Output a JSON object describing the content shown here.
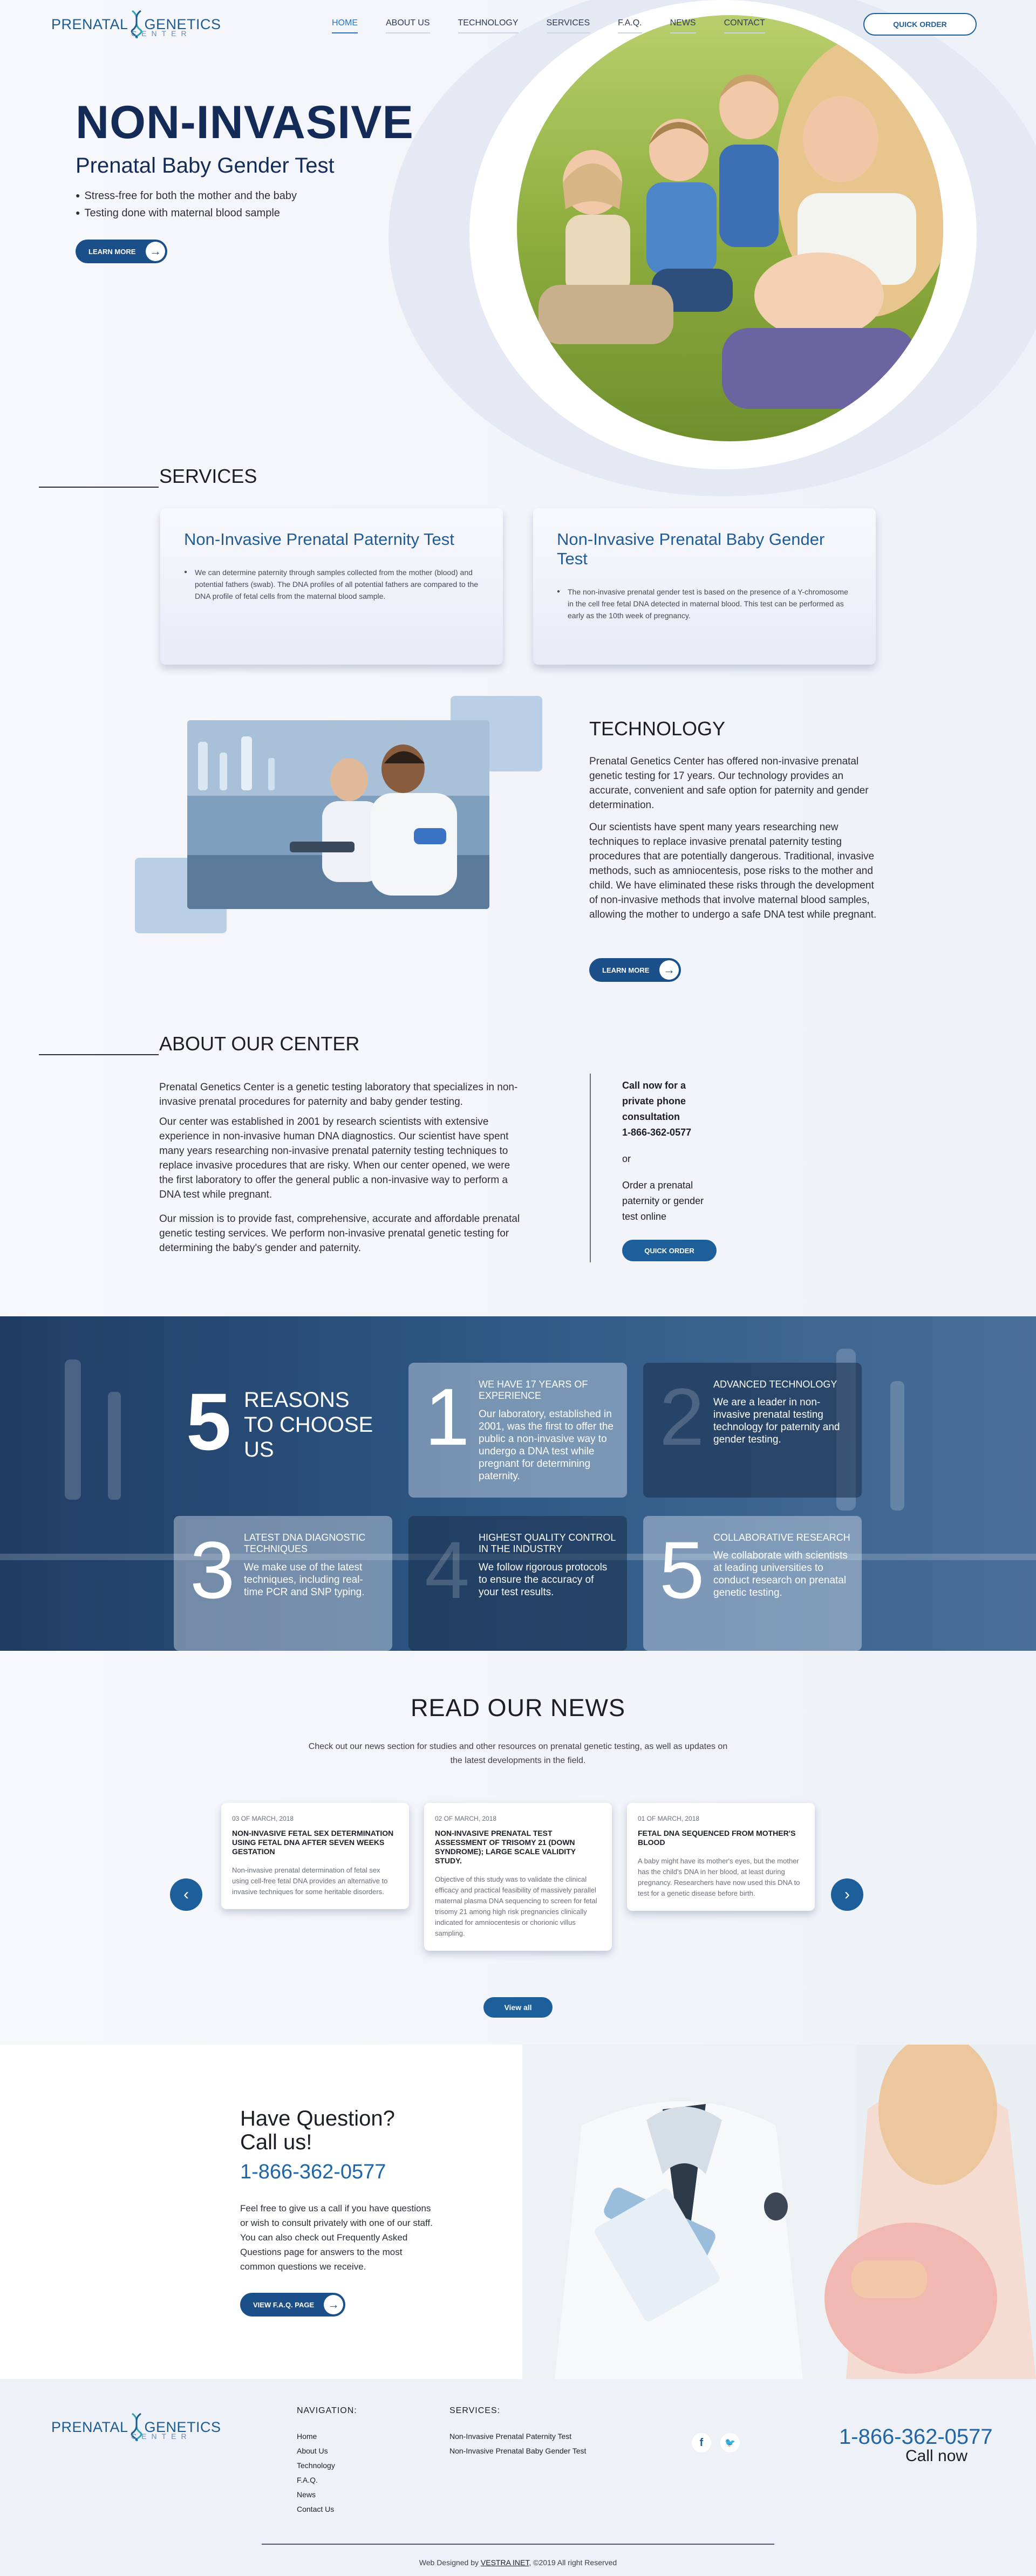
{
  "brand": {
    "word1": "PRENATAL",
    "word2": "GENETICS",
    "sub": "CENTER"
  },
  "nav": {
    "items": [
      "HOME",
      "ABOUT US",
      "TECHNOLOGY",
      "SERVICES",
      "F.A.Q.",
      "NEWS",
      "CONTACT"
    ],
    "active": "HOME"
  },
  "header": {
    "quick_order": "QUICK ORDER"
  },
  "hero": {
    "title": "NON-INVASIVE",
    "subtitle": "Prenatal Baby Gender Test",
    "bullets": [
      "Stress-free for both the mother and the baby",
      "Testing done with maternal blood sample"
    ],
    "button": "LEARN MORE"
  },
  "services": {
    "heading": "SERVICES",
    "cards": [
      {
        "title": "Non-Invasive Prenatal Paternity Test",
        "text": "We can determine paternity through samples collected from the mother (blood) and potential fathers (swab). The DNA profiles of all potential fathers are compared to the DNA profile of fetal cells from the maternal blood sample."
      },
      {
        "title": "Non-Invasive Prenatal Baby Gender Test",
        "text": "The non-invasive prenatal gender test is based on the presence of a Y-chromosome in the cell free fetal DNA detected in maternal blood. This test can be performed as early as the 10th week of pregnancy."
      }
    ]
  },
  "technology": {
    "heading": "TECHNOLOGY",
    "p1": "Prenatal Genetics Center has offered non-invasive prenatal genetic testing for 17 years. Our technology provides an accurate, convenient and safe option for paternity and gender determination.",
    "p2": "Our scientists have spent many years researching new techniques to replace invasive prenatal paternity testing procedures that are potentially dangerous. Traditional, invasive methods, such as amniocentesis, pose risks to the mother and child. We have eliminated these risks through the development of non-invasive methods that involve maternal blood samples, allowing the mother to undergo a safe DNA test while pregnant.",
    "button": "LEARN MORE"
  },
  "about": {
    "heading": "ABOUT OUR CENTER",
    "p1": "Prenatal Genetics Center is a genetic testing laboratory that specializes in non-invasive prenatal procedures for paternity and baby gender testing.",
    "p2": "Our center was established in 2001 by research scientists with extensive experience in non-invasive human DNA diagnostics. Our scientist have spent many years researching non-invasive prenatal paternity testing techniques to replace invasive procedures that are risky. When our center opened, we were the first laboratory to offer the general public a non-invasive way to perform a DNA test while pregnant.",
    "p3": "Our mission is to provide fast, comprehensive, accurate and affordable prenatal genetic testing services. We perform non-invasive prenatal genetic testing for determining the baby's gender and paternity.",
    "side_call": "Call now for a private phone consultation",
    "side_phone": "1-866-362-0577",
    "side_or": "or",
    "side_order": "Order a prenatal paternity or gender test online",
    "side_button": "QUICK ORDER"
  },
  "reasons": {
    "big_number": "5",
    "heading": "REASONS TO CHOOSE US",
    "items": [
      {
        "num": "1",
        "title": "WE HAVE 17 YEARS OF EXPERIENCE",
        "text": "Our laboratory, established in 2001, was the first to offer the public a non-invasive way to undergo a DNA test while pregnant for determining paternity."
      },
      {
        "num": "2",
        "title": "ADVANCED TECHNOLOGY",
        "text": "We are a leader in non-invasive prenatal testing technology for paternity and gender testing."
      },
      {
        "num": "3",
        "title": "LATEST DNA DIAGNOSTIC TECHNIQUES",
        "text": "We make use of the latest techniques, including real-time PCR and SNP typing."
      },
      {
        "num": "4",
        "title": "HIGHEST QUALITY CONTROL IN THE INDUSTRY",
        "text": "We follow rigorous protocols to ensure the accuracy of your test results."
      },
      {
        "num": "5",
        "title": "COLLABORATIVE RESEARCH",
        "text": "We collaborate with scientists at leading universities to conduct research on prenatal genetic testing."
      }
    ]
  },
  "news": {
    "heading": "READ OUR NEWS",
    "intro": "Check out our news section for studies and other resources on prenatal genetic testing, as well as updates on the latest developments in the field.",
    "cards": [
      {
        "date": "03 OF MARCH, 2018",
        "title": "Non-invasive fetal sex determination using fetal DNA after seven weeks gestation",
        "body": "Non-invasive prenatal determination of fetal sex using cell-free fetal DNA provides an alternative to invasive techniques for some heritable disorders."
      },
      {
        "date": "02 OF MARCH, 2018",
        "title": "Non-invasive prenatal test assessment of trisomy 21 (Down syndrome); large scale validity study.",
        "body": "Objective of this study was to validate the clinical efficacy and practical feasibility of massively parallel maternal plasma DNA sequencing to screen for fetal trisomy 21 among high risk pregnancies clinically indicated for amniocentesis or chorionic villus sampling."
      },
      {
        "date": "01 OF MARCH, 2018",
        "title": "Fetal DNA sequenced from mother's blood",
        "body": "A baby might have its mother's eyes, but the mother has the child's DNA in her blood, at least during pregnancy. Researchers have now used this DNA to test for a genetic disease before birth."
      }
    ],
    "view_all": "View all"
  },
  "question": {
    "heading": "Have Question? Call us!",
    "phone": "1-866-362-0577",
    "text": "Feel free to give us a call if you have questions or wish to consult privately with one of our staff. You can also check out Frequently Asked Questions page for answers to the most common questions we receive.",
    "button": "VIEW F.A.Q. PAGE"
  },
  "footer": {
    "nav_heading": "NAVIGATION:",
    "nav_items": [
      "Home",
      "About Us",
      "Technology",
      "F.A.Q.",
      "News",
      "Contact Us"
    ],
    "services_heading": "SERVICES:",
    "services_items": [
      "Non-Invasive Prenatal Paternity Test",
      "Non-Invasive Prenatal Baby Gender Test"
    ],
    "facebook": "f",
    "twitter": "🐦",
    "phone": "1-866-362-0577",
    "call_now": "Call now",
    "copy_prefix": "Web Designed by ",
    "copy_link": "VESTRA INET",
    "copy_suffix": ", ©2019 All right Reserved"
  },
  "colors": {
    "brand": "#1d5f9a",
    "navy": "#142a57",
    "reasons_bg": "#2f5a87"
  }
}
